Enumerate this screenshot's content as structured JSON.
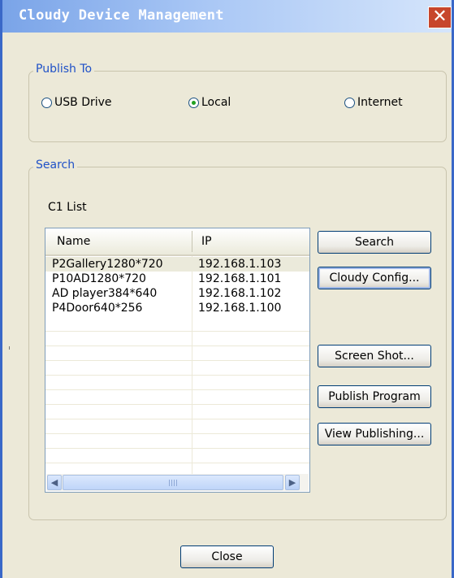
{
  "window": {
    "title": "Cloudy Device Management",
    "close_glyph": "✕"
  },
  "publish_to": {
    "legend": "Publish To",
    "options": [
      {
        "label": "USB Drive",
        "selected": false
      },
      {
        "label": "Local",
        "selected": true
      },
      {
        "label": "Internet",
        "selected": false
      }
    ]
  },
  "search": {
    "legend": "Search",
    "list_label": "C1 List",
    "columns": [
      "Name",
      "IP"
    ],
    "rows": [
      {
        "name": "P2Gallery1280*720",
        "ip": "192.168.1.103"
      },
      {
        "name": "P10AD1280*720",
        "ip": "192.168.1.101"
      },
      {
        "name": "AD player384*640",
        "ip": "192.168.1.102"
      },
      {
        "name": "P4Door640*256",
        "ip": "192.168.1.100"
      }
    ],
    "buttons": {
      "search": "Search",
      "cloudy_config": "Cloudy Config...",
      "screen_shot": "Screen Shot...",
      "publish_program": "Publish Program",
      "view_publishing": "View Publishing..."
    },
    "scroll_left_glyph": "◀",
    "scroll_right_glyph": "▶"
  },
  "footer": {
    "close_label": "Close"
  },
  "colors": {
    "title_gradient_start": "#7aa4e8",
    "title_gradient_end": "#d5e5fb",
    "close_button": "#c7462c",
    "legend_text": "#1f51c7",
    "dialog_bg": "#ece9d8"
  }
}
